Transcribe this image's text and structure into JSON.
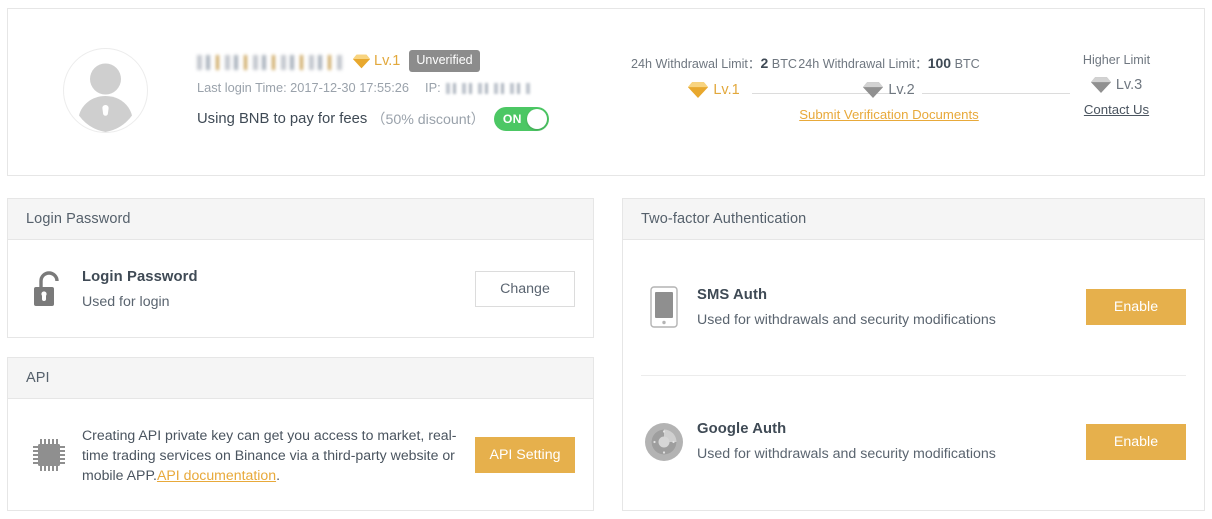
{
  "profile": {
    "avatar_alt": "user-avatar",
    "username_redacted": true,
    "level_badge": "Lv.1",
    "verification_status": "Unverified",
    "last_login_label": "Last login Time: 2017-12-30 17:55:26",
    "ip_label": "IP:",
    "ip_redacted": true,
    "bnb_text": "Using BNB to pay for fees",
    "bnb_discount": "（50% discount）",
    "bnb_toggle_state": "ON"
  },
  "levels": [
    {
      "caption_prefix": "24h Withdrawal Limit：",
      "caption_value": "2",
      "caption_suffix": " BTC",
      "name": "Lv.1",
      "active": true,
      "link": "",
      "link_style": ""
    },
    {
      "caption_prefix": "24h Withdrawal Limit：",
      "caption_value": "100",
      "caption_suffix": " BTC",
      "name": "Lv.2",
      "active": false,
      "link": "Submit Verification Documents",
      "link_style": "gold"
    },
    {
      "caption_prefix": "Higher Limit",
      "caption_value": "",
      "caption_suffix": "",
      "name": "Lv.3",
      "active": false,
      "link": "Contact Us",
      "link_style": "dark"
    }
  ],
  "login_password": {
    "panel_title": "Login Password",
    "row_title": "Login Password",
    "row_sub": "Used for login",
    "button": "Change"
  },
  "api": {
    "panel_title": "API",
    "text_part1": "Creating API private key can get you access to market, real-time trading services on Binance via a third-party website or mobile APP.",
    "link_text": "API documentation",
    "text_part2": ".",
    "button": "API Setting"
  },
  "two_factor": {
    "panel_title": "Two-factor Authentication",
    "rows": [
      {
        "icon": "phone-icon",
        "title": "SMS Auth",
        "sub": "Used for withdrawals and security modifications",
        "button": "Enable"
      },
      {
        "icon": "google-auth-icon",
        "title": "Google Auth",
        "sub": "Used for withdrawals and security modifications",
        "button": "Enable"
      }
    ]
  },
  "colors": {
    "gold": "#e6b04c",
    "gold_text": "#e2a83c",
    "toggle_green": "#4cc764",
    "badge_grey": "#8c8c8c",
    "panel_head": "#f5f5f5",
    "border": "#e6e6e6"
  }
}
